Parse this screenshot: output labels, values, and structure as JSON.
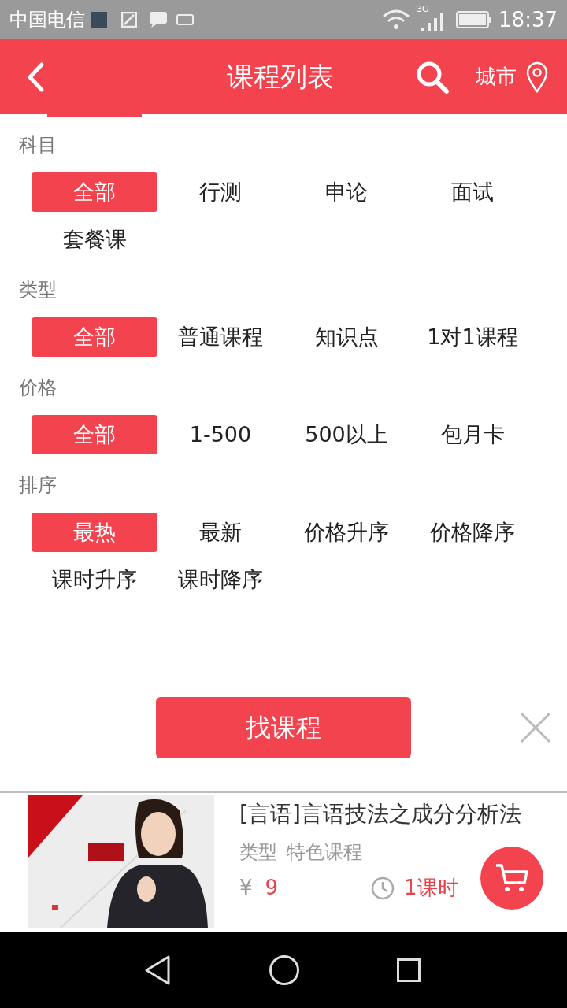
{
  "status_bar": {
    "carrier": "中国电信",
    "time": "18:37",
    "network": "3G"
  },
  "header": {
    "title": "课程列表",
    "city": "城市"
  },
  "filters": [
    {
      "label": "科目",
      "options": [
        {
          "label": "全部",
          "selected": true
        },
        {
          "label": "行测",
          "selected": false
        },
        {
          "label": "申论",
          "selected": false
        },
        {
          "label": "面试",
          "selected": false
        },
        {
          "label": "套餐课",
          "selected": false
        }
      ]
    },
    {
      "label": "类型",
      "options": [
        {
          "label": "全部",
          "selected": true
        },
        {
          "label": "普通课程",
          "selected": false
        },
        {
          "label": "知识点",
          "selected": false
        },
        {
          "label": "1对1课程",
          "selected": false
        }
      ]
    },
    {
      "label": "价格",
      "options": [
        {
          "label": "全部",
          "selected": true
        },
        {
          "label": "1-500",
          "selected": false
        },
        {
          "label": "500以上",
          "selected": false
        },
        {
          "label": "包月卡",
          "selected": false
        }
      ]
    },
    {
      "label": "排序",
      "options": [
        {
          "label": "最热",
          "selected": true
        },
        {
          "label": "最新",
          "selected": false
        },
        {
          "label": "价格升序",
          "selected": false
        },
        {
          "label": "价格降序",
          "selected": false
        },
        {
          "label": "课时升序",
          "selected": false
        },
        {
          "label": "课时降序",
          "selected": false
        }
      ]
    }
  ],
  "search_button": "找课程",
  "course": {
    "title": "[言语]言语技法之成分分析法",
    "type_label": "类型",
    "type_value": "特色课程",
    "price_symbol": "¥",
    "price": "9",
    "duration": "1课时"
  }
}
